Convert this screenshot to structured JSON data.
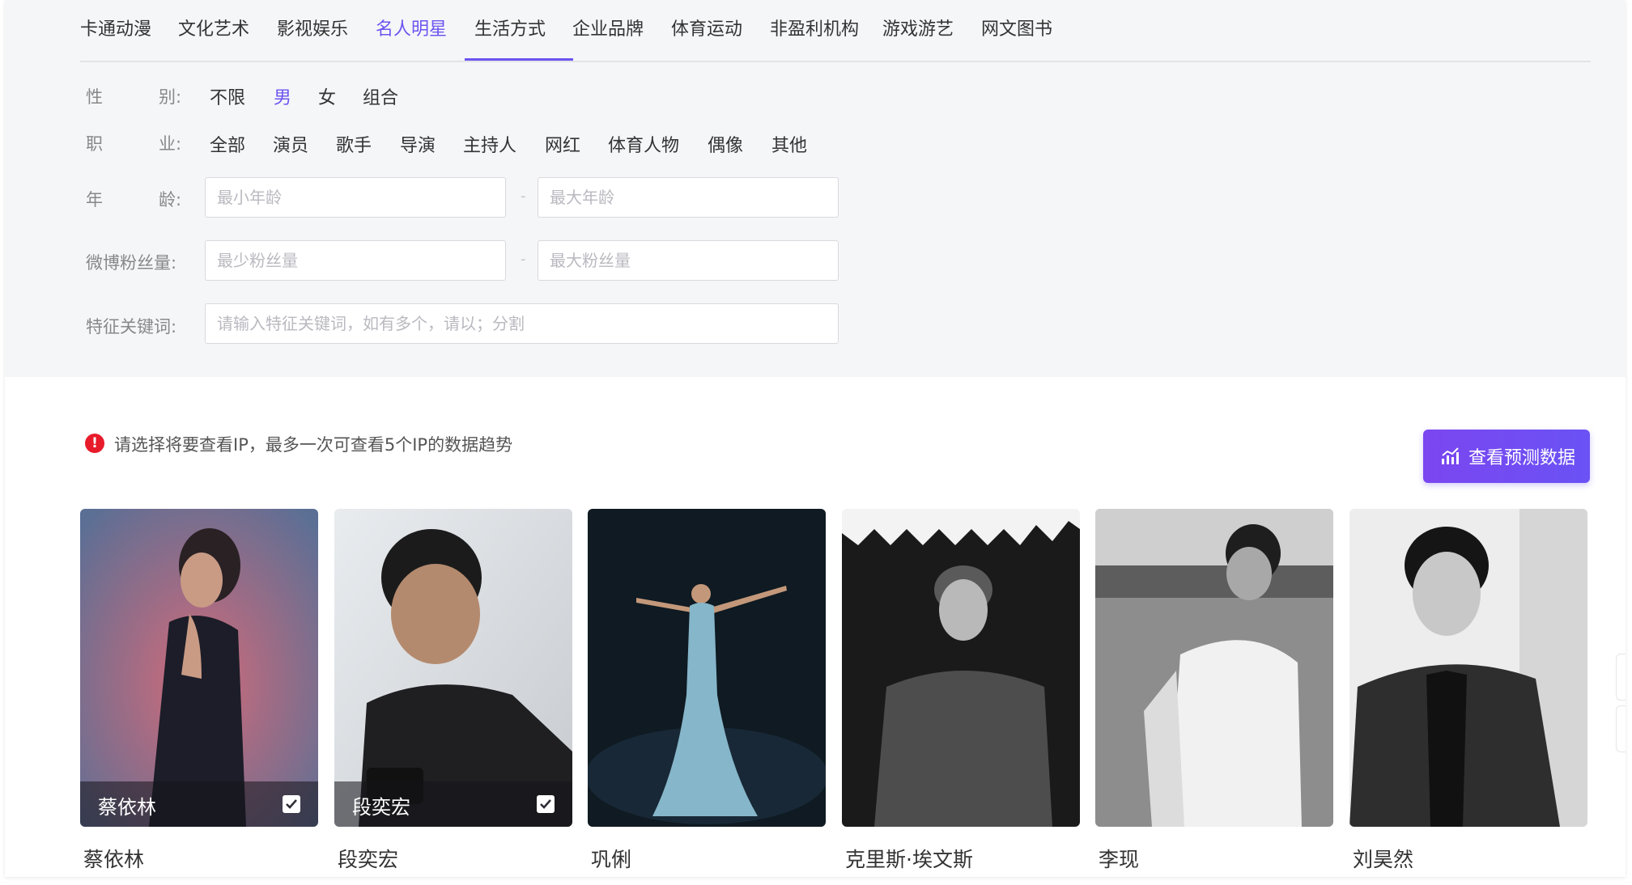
{
  "tabs": [
    "卡通动漫",
    "文化艺术",
    "影视娱乐",
    "名人明星",
    "生活方式",
    "企业品牌",
    "体育运动",
    "非盈利机构",
    "游戏游艺",
    "网文图书"
  ],
  "active_tab": "名人明星",
  "filters": {
    "gender": {
      "label_a": "性",
      "label_b": "别:",
      "options": [
        "不限",
        "男",
        "女",
        "组合"
      ],
      "selected": "男"
    },
    "occupation": {
      "label_a": "职",
      "label_b": "业:",
      "options": [
        "全部",
        "演员",
        "歌手",
        "导演",
        "主持人",
        "网红",
        "体育人物",
        "偶像",
        "其他"
      ]
    },
    "age": {
      "label_a": "年",
      "label_b": "龄:",
      "min_placeholder": "最小年龄",
      "max_placeholder": "最大年龄",
      "separator": "-"
    },
    "weibo_fans": {
      "label": "微博粉丝量:",
      "min_placeholder": "最少粉丝量",
      "max_placeholder": "最大粉丝量",
      "separator": "-"
    },
    "keywords": {
      "label": "特征关键词:",
      "placeholder": "请输入特征关键词，如有多个，请以；分割"
    }
  },
  "notice": {
    "icon": "alert-icon",
    "text": "请选择将要查看IP，最多一次可查看5个IP的数据趋势"
  },
  "predict_button": {
    "icon": "chart-bars-icon",
    "label": "查看预测数据"
  },
  "celebrities": [
    {
      "name": "蔡依林",
      "selected": true
    },
    {
      "name": "段奕宏",
      "selected": true
    },
    {
      "name": "巩俐",
      "selected": false
    },
    {
      "name": "克里斯·埃文斯",
      "selected": false
    },
    {
      "name": "李现",
      "selected": false
    },
    {
      "name": "刘昊然",
      "selected": false
    }
  ],
  "colors": {
    "accent": "#6c55f0",
    "button_gradient_start": "#7b46f0",
    "alert": "#e81b2b",
    "panel_bg": "#f5f6f8"
  }
}
